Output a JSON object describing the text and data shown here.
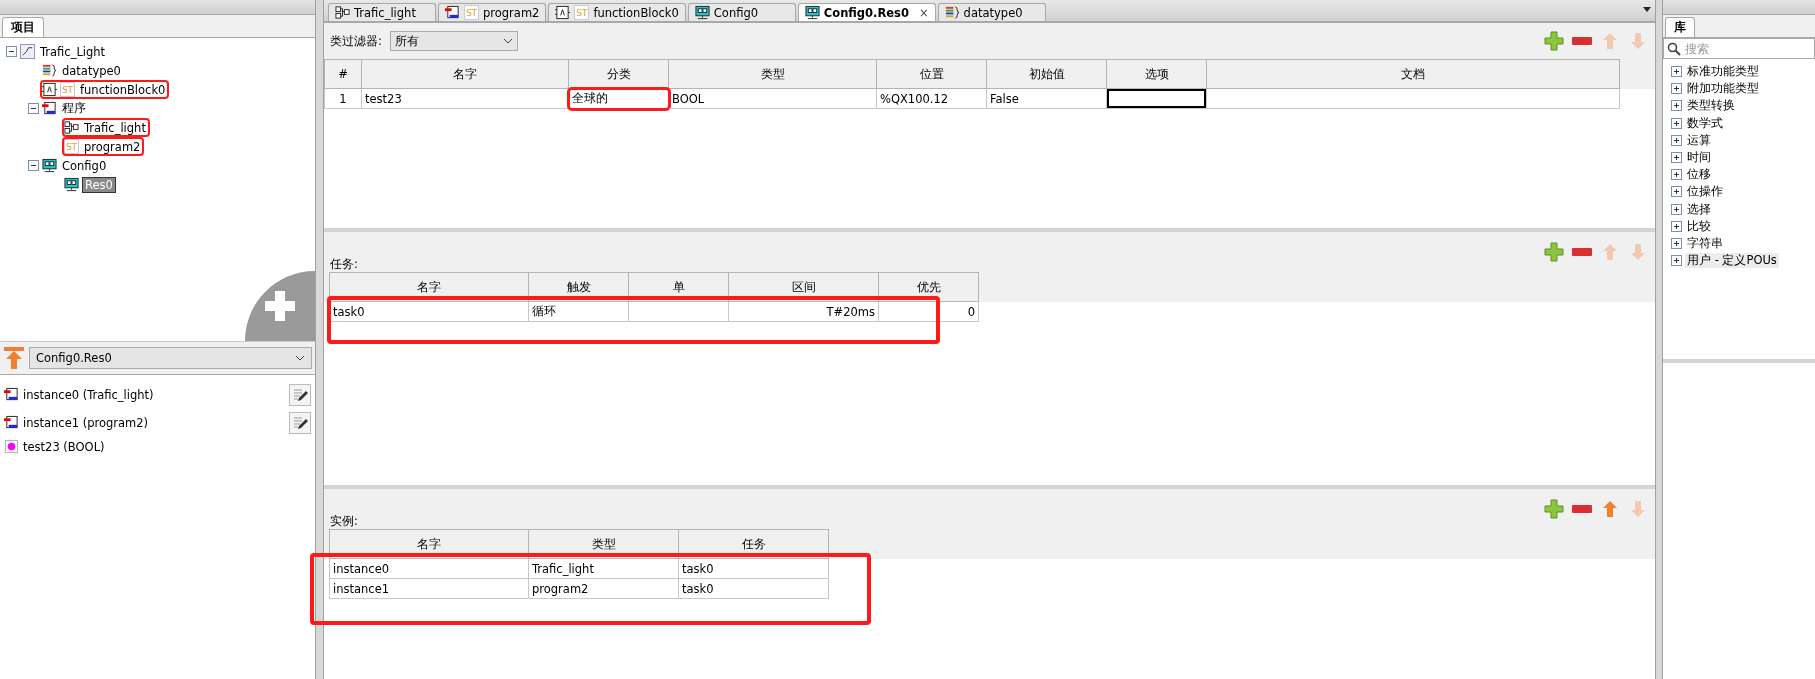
{
  "project_panel": {
    "tab": "项目",
    "tree": [
      {
        "label": "Trafic_Light",
        "kind": "project",
        "expanded": true,
        "selected": false,
        "annotated": false,
        "children": [
          {
            "label": "datatype0",
            "kind": "datatype",
            "selected": false,
            "annotated": false
          },
          {
            "label": "functionBlock0",
            "kind": "fb",
            "badge": "ST",
            "selected": false,
            "annotated": true
          },
          {
            "label": "程序",
            "kind": "folder",
            "expanded": true,
            "selected": false,
            "annotated": false,
            "children": [
              {
                "label": "Trafic_light",
                "kind": "graphic",
                "selected": false,
                "annotated": true
              },
              {
                "label": "program2",
                "kind": "st",
                "badge": "ST",
                "selected": false,
                "annotated": true
              }
            ]
          },
          {
            "label": "Config0",
            "kind": "config",
            "expanded": true,
            "selected": false,
            "annotated": false,
            "children": [
              {
                "label": "Res0",
                "kind": "config",
                "selected": true,
                "annotated": false
              }
            ]
          }
        ]
      }
    ]
  },
  "instance_panel": {
    "dropdown": "Config0.Res0",
    "items": [
      {
        "label": "instance0 (Trafic_light)",
        "kind": "instance"
      },
      {
        "label": "instance1 (program2)",
        "kind": "instance"
      },
      {
        "label": "test23 (BOOL)",
        "kind": "variable"
      }
    ]
  },
  "tabs": [
    {
      "label": "Trafic_light",
      "kind": "graphic",
      "selected": false
    },
    {
      "label": "program2",
      "kind": "st",
      "badge": "ST",
      "selected": false
    },
    {
      "label": "functionBlock0",
      "kind": "fb",
      "badge": "ST",
      "selected": false
    },
    {
      "label": "Config0",
      "kind": "config",
      "selected": false
    },
    {
      "label": "Config0.Res0",
      "kind": "config",
      "selected": true,
      "close": "×"
    },
    {
      "label": "datatype0",
      "kind": "datatype",
      "selected": false
    }
  ],
  "variables": {
    "filter_label": "类过滤器:",
    "filter_value": "所有",
    "toolbar": {
      "up_disabled": true,
      "down_disabled": true
    },
    "columns": [
      "#",
      "名字",
      "分类",
      "类型",
      "位置",
      "初始值",
      "选项",
      "文档"
    ],
    "rows": [
      {
        "cells": [
          {
            "text": "1"
          },
          {
            "text": "test23"
          },
          {
            "text": "全球的",
            "annotated": true
          },
          {
            "text": "BOOL"
          },
          {
            "text": "%QX100.12"
          },
          {
            "text": "False"
          },
          {
            "focused": true
          },
          {}
        ]
      }
    ]
  },
  "tasks": {
    "label": "任务:",
    "toolbar": {
      "up_disabled": true,
      "down_disabled": true
    },
    "annotated": true,
    "columns": [
      "名字",
      "触发",
      "单",
      "区间",
      "优先"
    ],
    "rows": [
      [
        "task0",
        "循环",
        "",
        "T#20ms",
        "0"
      ]
    ]
  },
  "instances": {
    "label": "实例:",
    "toolbar": {
      "up_disabled": false,
      "down_disabled": true
    },
    "annotated": true,
    "columns": [
      "名字",
      "类型",
      "任务"
    ],
    "rows": [
      [
        "instance0",
        "Trafic_light",
        "task0"
      ],
      [
        "instance1",
        "program2",
        "task0"
      ]
    ]
  },
  "library": {
    "tab": "库",
    "search_placeholder": "搜索",
    "items": [
      {
        "label": "标准功能类型",
        "selected": false
      },
      {
        "label": "附加功能类型",
        "selected": false
      },
      {
        "label": "类型转换",
        "selected": false
      },
      {
        "label": "数学式",
        "selected": false
      },
      {
        "label": "运算",
        "selected": false
      },
      {
        "label": "时间",
        "selected": false
      },
      {
        "label": "位移",
        "selected": false
      },
      {
        "label": "位操作",
        "selected": false
      },
      {
        "label": "选择",
        "selected": false
      },
      {
        "label": "比较",
        "selected": false
      },
      {
        "label": "字符串",
        "selected": false
      },
      {
        "label": "用户 - 定义POUs",
        "selected": true
      }
    ]
  }
}
